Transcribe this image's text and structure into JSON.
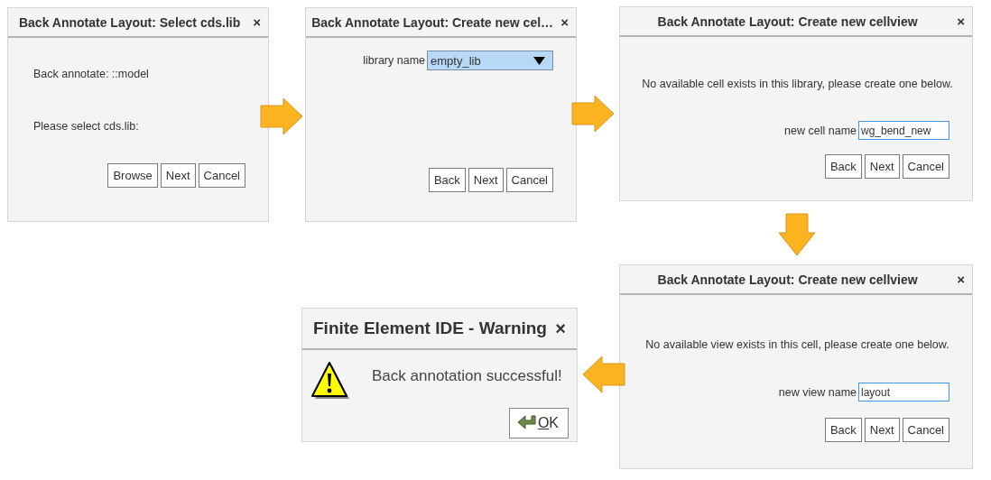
{
  "dialogs": [
    {
      "kind": "select",
      "title": "Back Annotate Layout: Select cds.lib",
      "close": "×",
      "lines": [
        "Back annotate: ::model",
        "Please select cds.lib:"
      ],
      "buttons": [
        "Browse",
        "Next",
        "Cancel"
      ]
    },
    {
      "kind": "library",
      "title": "Back Annotate Layout: Create new cel…",
      "close": "×",
      "field": {
        "label": "library name",
        "value": "empty_lib"
      },
      "buttons": [
        "Back",
        "Next",
        "Cancel"
      ]
    },
    {
      "kind": "create",
      "title": "Back Annotate Layout: Create new cellview",
      "close": "×",
      "message": "No available cell exists in this library, please create one below.",
      "field": {
        "label": "new cell name",
        "value": "wg_bend_new"
      },
      "buttons": [
        "Back",
        "Next",
        "Cancel"
      ]
    },
    {
      "kind": "warning",
      "title": "Finite Element IDE - Warning",
      "close": "×",
      "message": "Back annotation successful!",
      "buttons": [
        "OK"
      ]
    },
    {
      "kind": "create",
      "title": "Back Annotate Layout: Create new cellview",
      "close": "×",
      "message": "No available view exists in this cell, please create one below.",
      "field": {
        "label": "new view name",
        "value": "layout"
      },
      "buttons": [
        "Back",
        "Next",
        "Cancel"
      ]
    }
  ]
}
